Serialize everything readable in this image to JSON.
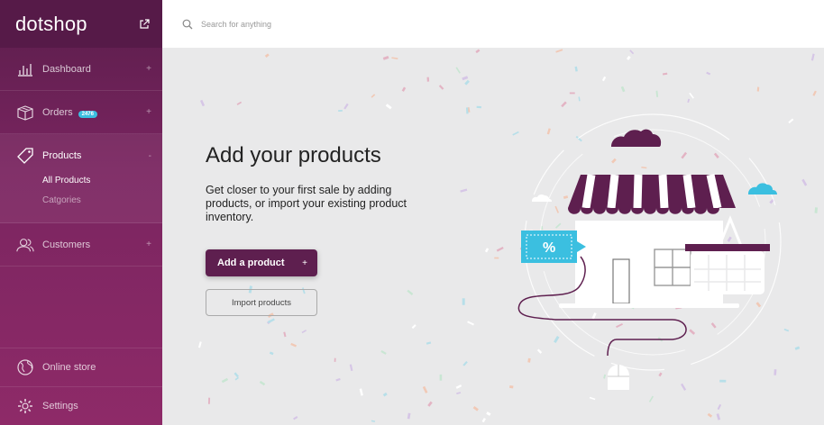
{
  "brand": {
    "name": "dotshop",
    "external_icon": "external-link-icon"
  },
  "sidebar": {
    "items": [
      {
        "label": "Dashboard",
        "icon": "bar-chart-icon",
        "expand": "+"
      },
      {
        "label": "Orders",
        "icon": "box-icon",
        "badge": "2476",
        "expand": "+"
      },
      {
        "label": "Products",
        "icon": "tag-icon",
        "expand": "-"
      },
      {
        "label": "Customers",
        "icon": "users-icon",
        "expand": "+"
      }
    ],
    "products_sub": [
      {
        "label": "All Products"
      },
      {
        "label": "Catgories"
      }
    ],
    "bottom": [
      {
        "label": "Online store",
        "icon": "globe-icon"
      },
      {
        "label": "Settings",
        "icon": "gear-icon"
      }
    ]
  },
  "search": {
    "placeholder": "Search for anything",
    "icon": "search-icon"
  },
  "main": {
    "title": "Add your products",
    "description": "Get closer to your first sale by adding products, or import your existing product inventory.",
    "primary_button": "Add a product",
    "primary_button_icon": "+",
    "secondary_button": "Import products",
    "tag_symbol": "%"
  },
  "colors": {
    "brand_dark": "#5a1d4b",
    "brand": "#7a2560",
    "accent_blue": "#3bbfe0",
    "background": "#e9e9ea"
  }
}
